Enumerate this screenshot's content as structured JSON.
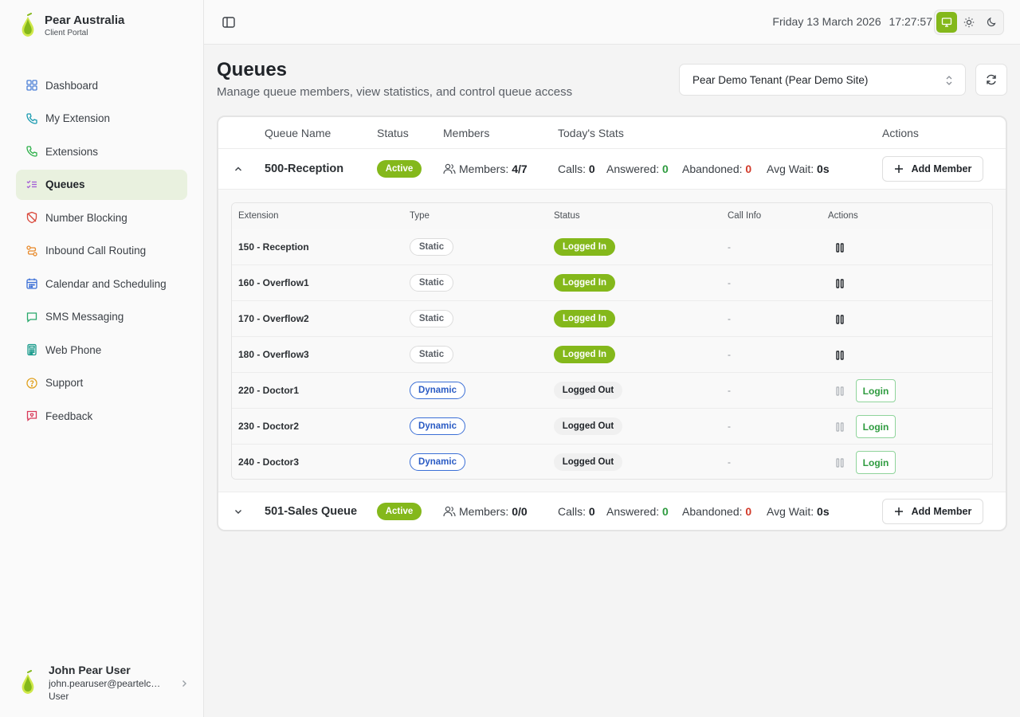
{
  "brand": {
    "title": "Pear Australia",
    "subtitle": "Client Portal"
  },
  "colors": {
    "accent": "#84b81b",
    "active_nav_bg": "#e9f1df",
    "good": "#2e9b3f",
    "bad": "#d23a2a",
    "dynamic": "#2a5bc4"
  },
  "sidebar": {
    "items": [
      {
        "label": "Dashboard",
        "icon": "dashboard-icon"
      },
      {
        "label": "My Extension",
        "icon": "phone-icon"
      },
      {
        "label": "Extensions",
        "icon": "phone-icon"
      },
      {
        "label": "Queues",
        "icon": "list-checks-icon",
        "active": true
      },
      {
        "label": "Number Blocking",
        "icon": "shield-off-icon"
      },
      {
        "label": "Inbound Call Routing",
        "icon": "route-icon"
      },
      {
        "label": "Calendar and Scheduling",
        "icon": "calendar-icon"
      },
      {
        "label": "SMS Messaging",
        "icon": "message-icon"
      },
      {
        "label": "Web Phone",
        "icon": "calculator-icon"
      },
      {
        "label": "Support",
        "icon": "help-circle-icon"
      },
      {
        "label": "Feedback",
        "icon": "feedback-icon"
      }
    ]
  },
  "user": {
    "name": "John Pear User",
    "email": "john.pearuser@peartelco.com.au",
    "role": "User"
  },
  "topbar": {
    "date": "Friday 13 March 2026",
    "time": "17:27:57",
    "theme_active": "system"
  },
  "page": {
    "title": "Queues",
    "subtitle": "Manage queue members, view statistics, and control queue access",
    "tenant": "Pear Demo Tenant (Pear Demo Site)"
  },
  "table": {
    "headers": {
      "name": "Queue Name",
      "status": "Status",
      "members": "Members",
      "stats": "Today's Stats",
      "actions": "Actions"
    },
    "queues": [
      {
        "name": "500-Reception",
        "status": "Active",
        "expanded": true,
        "members_label": "Members:",
        "members_value": "4/7",
        "calls_label": "Calls:",
        "calls": "0",
        "answered_label": "Answered:",
        "answered": "0",
        "abandoned_label": "Abandoned:",
        "abandoned": "0",
        "avgwait_label": "Avg Wait:",
        "avgwait": "0s",
        "add_label": "Add Member"
      },
      {
        "name": "501-Sales Queue",
        "status": "Active",
        "expanded": false,
        "members_label": "Members:",
        "members_value": "0/0",
        "calls_label": "Calls:",
        "calls": "0",
        "answered_label": "Answered:",
        "answered": "0",
        "abandoned_label": "Abandoned:",
        "abandoned": "0",
        "avgwait_label": "Avg Wait:",
        "avgwait": "0s",
        "add_label": "Add Member"
      }
    ],
    "member_headers": {
      "extension": "Extension",
      "type": "Type",
      "status": "Status",
      "call_info": "Call Info",
      "actions": "Actions"
    },
    "members": [
      {
        "extension": "150 - Reception",
        "type": "Static",
        "status": "Logged In",
        "call_info": "-",
        "login": ""
      },
      {
        "extension": "160 - Overflow1",
        "type": "Static",
        "status": "Logged In",
        "call_info": "-",
        "login": ""
      },
      {
        "extension": "170 - Overflow2",
        "type": "Static",
        "status": "Logged In",
        "call_info": "-",
        "login": ""
      },
      {
        "extension": "180 - Overflow3",
        "type": "Static",
        "status": "Logged In",
        "call_info": "-",
        "login": ""
      },
      {
        "extension": "220 - Doctor1",
        "type": "Dynamic",
        "status": "Logged Out",
        "call_info": "-",
        "login": "Login"
      },
      {
        "extension": "230 - Doctor2",
        "type": "Dynamic",
        "status": "Logged Out",
        "call_info": "-",
        "login": "Login"
      },
      {
        "extension": "240 - Doctor3",
        "type": "Dynamic",
        "status": "Logged Out",
        "call_info": "-",
        "login": "Login"
      }
    ]
  }
}
